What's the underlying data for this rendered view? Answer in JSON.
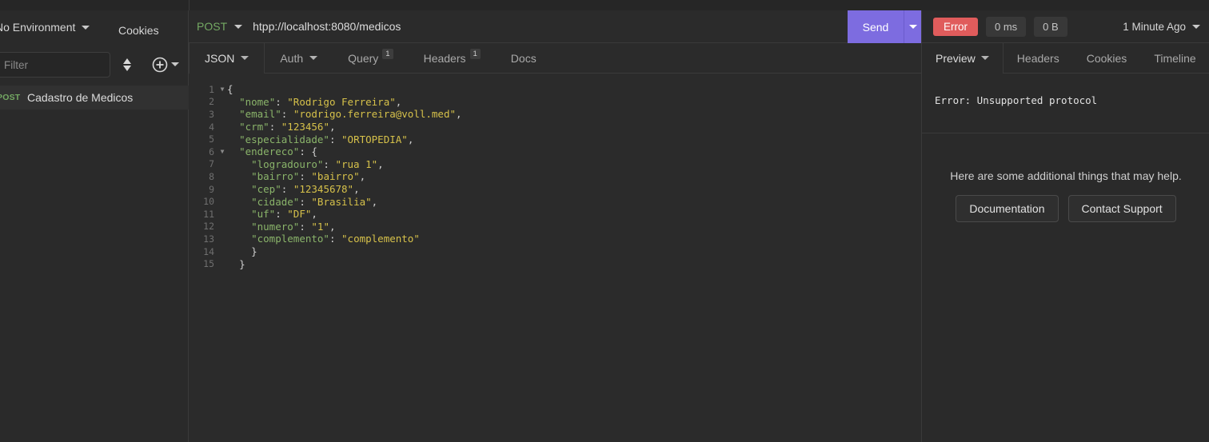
{
  "sidebar": {
    "environment_label": "No Environment",
    "cookies_label": "Cookies",
    "filter_placeholder": "Filter",
    "request": {
      "method": "POST",
      "name": "Cadastro de Medicos"
    }
  },
  "request_pane": {
    "method": "POST",
    "url": "htpp://localhost:8080/medicos",
    "send_label": "Send",
    "tabs": [
      {
        "label": "JSON",
        "badge": "",
        "has_caret": true,
        "active": true
      },
      {
        "label": "Auth",
        "badge": "",
        "has_caret": true,
        "active": false
      },
      {
        "label": "Query",
        "badge": "1",
        "has_caret": false,
        "active": false
      },
      {
        "label": "Headers",
        "badge": "1",
        "has_caret": false,
        "active": false
      },
      {
        "label": "Docs",
        "badge": "",
        "has_caret": false,
        "active": false
      }
    ],
    "body_lines": [
      {
        "n": "1",
        "fold": true,
        "indent": 0,
        "tokens": [
          [
            "p",
            "{"
          ]
        ]
      },
      {
        "n": "2",
        "fold": false,
        "indent": 1,
        "tokens": [
          [
            "k",
            "\"nome\""
          ],
          [
            "p",
            ": "
          ],
          [
            "s",
            "\"Rodrigo Ferreira\""
          ],
          [
            "p",
            ","
          ]
        ]
      },
      {
        "n": "3",
        "fold": false,
        "indent": 1,
        "tokens": [
          [
            "k",
            "\"email\""
          ],
          [
            "p",
            ": "
          ],
          [
            "s",
            "\"rodrigo.ferreira@voll.med\""
          ],
          [
            "p",
            ","
          ]
        ]
      },
      {
        "n": "4",
        "fold": false,
        "indent": 1,
        "tokens": [
          [
            "k",
            "\"crm\""
          ],
          [
            "p",
            ": "
          ],
          [
            "s",
            "\"123456\""
          ],
          [
            "p",
            ","
          ]
        ]
      },
      {
        "n": "5",
        "fold": false,
        "indent": 1,
        "tokens": [
          [
            "k",
            "\"especialidade\""
          ],
          [
            "p",
            ": "
          ],
          [
            "s",
            "\"ORTOPEDIA\""
          ],
          [
            "p",
            ","
          ]
        ]
      },
      {
        "n": "6",
        "fold": true,
        "indent": 1,
        "tokens": [
          [
            "k",
            "\"endereco\""
          ],
          [
            "p",
            ": {"
          ]
        ]
      },
      {
        "n": "7",
        "fold": false,
        "indent": 2,
        "tokens": [
          [
            "k",
            "\"logradouro\""
          ],
          [
            "p",
            ": "
          ],
          [
            "s",
            "\"rua 1\""
          ],
          [
            "p",
            ","
          ]
        ]
      },
      {
        "n": "8",
        "fold": false,
        "indent": 2,
        "tokens": [
          [
            "k",
            "\"bairro\""
          ],
          [
            "p",
            ": "
          ],
          [
            "s",
            "\"bairro\""
          ],
          [
            "p",
            ","
          ]
        ]
      },
      {
        "n": "9",
        "fold": false,
        "indent": 2,
        "tokens": [
          [
            "k",
            "\"cep\""
          ],
          [
            "p",
            ": "
          ],
          [
            "s",
            "\"12345678\""
          ],
          [
            "p",
            ","
          ]
        ]
      },
      {
        "n": "10",
        "fold": false,
        "indent": 2,
        "tokens": [
          [
            "k",
            "\"cidade\""
          ],
          [
            "p",
            ": "
          ],
          [
            "s",
            "\"Brasilia\""
          ],
          [
            "p",
            ","
          ]
        ]
      },
      {
        "n": "11",
        "fold": false,
        "indent": 2,
        "tokens": [
          [
            "k",
            "\"uf\""
          ],
          [
            "p",
            ": "
          ],
          [
            "s",
            "\"DF\""
          ],
          [
            "p",
            ","
          ]
        ]
      },
      {
        "n": "12",
        "fold": false,
        "indent": 2,
        "tokens": [
          [
            "k",
            "\"numero\""
          ],
          [
            "p",
            ": "
          ],
          [
            "s",
            "\"1\""
          ],
          [
            "p",
            ","
          ]
        ]
      },
      {
        "n": "13",
        "fold": false,
        "indent": 2,
        "tokens": [
          [
            "k",
            "\"complemento\""
          ],
          [
            "p",
            ": "
          ],
          [
            "s",
            "\"complemento\""
          ]
        ]
      },
      {
        "n": "14",
        "fold": false,
        "indent": 2,
        "tokens": [
          [
            "p",
            "}"
          ]
        ]
      },
      {
        "n": "15",
        "fold": false,
        "indent": 1,
        "tokens": [
          [
            "p",
            "}"
          ]
        ]
      }
    ]
  },
  "response_pane": {
    "status_label": "Error",
    "time_label": "0 ms",
    "size_label": "0 B",
    "time_ago_label": "1 Minute Ago",
    "tabs": [
      {
        "label": "Preview",
        "has_caret": true,
        "active": true
      },
      {
        "label": "Headers",
        "has_caret": false,
        "active": false
      },
      {
        "label": "Cookies",
        "has_caret": false,
        "active": false
      },
      {
        "label": "Timeline",
        "has_caret": false,
        "active": false
      }
    ],
    "error_message": "Error: Unsupported protocol",
    "help_text": "Here are some additional things that may help.",
    "help_buttons": [
      "Documentation",
      "Contact Support"
    ]
  },
  "colors": {
    "accent_send": "#7d6ce0",
    "status_error": "#e05c5c",
    "method_post": "#74a963",
    "json_key": "#8ab46a",
    "json_string": "#d6c14a"
  }
}
